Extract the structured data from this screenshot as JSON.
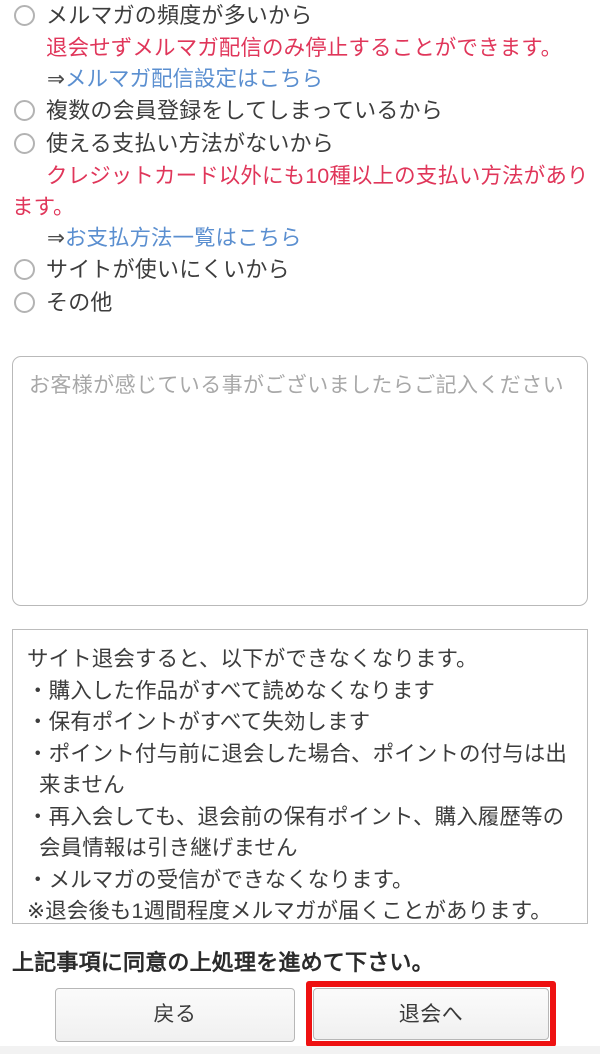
{
  "form": {
    "reasons": [
      {
        "label": "メルマガの頻度が多いから",
        "id": "reason-mailmagazine-frequency"
      },
      {
        "label": "複数の会員登録をしてしまっているから",
        "id": "reason-duplicate-account"
      },
      {
        "label": "使える支払い方法がないから",
        "id": "reason-no-payment-method"
      },
      {
        "label": "サイトが使いにくいから",
        "id": "reason-site-hard-to-use"
      },
      {
        "label": "その他",
        "id": "reason-other"
      }
    ],
    "notes": {
      "mailmagazine": {
        "red_text": "退会せずメルマガ配信のみ停止することができます。",
        "arrow": "⇒",
        "link_text": "メルマガ配信設定はこちら"
      },
      "payment": {
        "red_text": "クレジットカード以外にも10種以上の支払い方法があります。",
        "arrow": "⇒",
        "link_text": "お支払方法一覧はこちら"
      }
    },
    "comment": {
      "placeholder": "お客様が感じている事がございましたらご記入ください",
      "value": ""
    }
  },
  "notice": {
    "lines": [
      "サイト退会すると、以下ができなくなります。",
      "・購入した作品がすべて読めなくなります",
      "・保有ポイントがすべて失効します",
      "・ポイント付与前に退会した場合、ポイントの付与は出来ません",
      "・再入会しても、退会前の保有ポイント、購入履歴等の会員情報は引き継げません",
      "・メルマガの受信ができなくなります。",
      "※退会後も1週間程度メルマガが届くことがあります。"
    ]
  },
  "agreement": {
    "text": "上記事項に同意の上処理を進めて下さい。"
  },
  "buttons": {
    "back": "戻る",
    "withdraw": "退会へ"
  },
  "colors": {
    "red_note": "#e0365a",
    "link_blue": "#5b8fd0",
    "highlight_red": "#ee1111",
    "border_gray": "#b9b9b9",
    "text": "#3d3d3d"
  }
}
